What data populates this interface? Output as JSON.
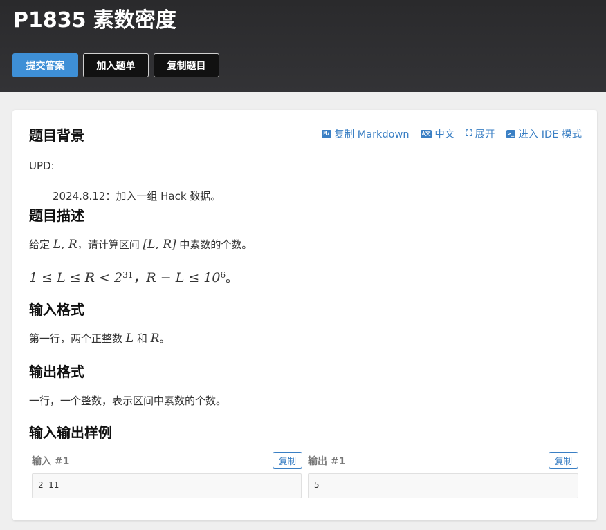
{
  "header": {
    "title": "P1835 素数密度",
    "buttons": {
      "submit": "提交答案",
      "add_to_list": "加入题单",
      "copy_problem": "复制题目"
    }
  },
  "toolbar": {
    "copy_markdown": "复制 Markdown",
    "chinese": "中文",
    "expand": "展开",
    "ide_mode": "进入 IDE 模式",
    "icons": {
      "markdown": "M↓",
      "translate": "A文",
      "expand": "[ ]",
      "ide": ">_"
    }
  },
  "sections": {
    "background": {
      "heading": "题目背景",
      "upd_label": "UPD:",
      "upd_item": "2024.8.12：加入一组 Hack 数据。"
    },
    "description": {
      "heading": "题目描述",
      "line1_prefix": "给定 ",
      "line1_mid": "，请计算区间 ",
      "line1_suffix": " 中素数的个数。",
      "vars_LR": "L, R",
      "interval": "[L, R]",
      "constraint": "1 ≤ L ≤ R < 2",
      "exp31": "31",
      "constraint2": "，R − L ≤ 10",
      "exp6": "6",
      "end": "。"
    },
    "input": {
      "heading": "输入格式",
      "text_prefix": "第一行，两个正整数 ",
      "var_L": "L",
      "and": " 和 ",
      "var_R": "R",
      "text_suffix": "。"
    },
    "output": {
      "heading": "输出格式",
      "text": "一行，一个整数，表示区间中素数的个数。"
    },
    "samples": {
      "heading": "输入输出样例",
      "input_label": "输入 #1",
      "output_label": "输出 #1",
      "copy": "复制",
      "input_value": "2 11",
      "output_value": "5"
    }
  },
  "colors": {
    "header_bg": "#2d2d2f",
    "primary": "#3e8fd6",
    "link": "#3a7fc4"
  }
}
